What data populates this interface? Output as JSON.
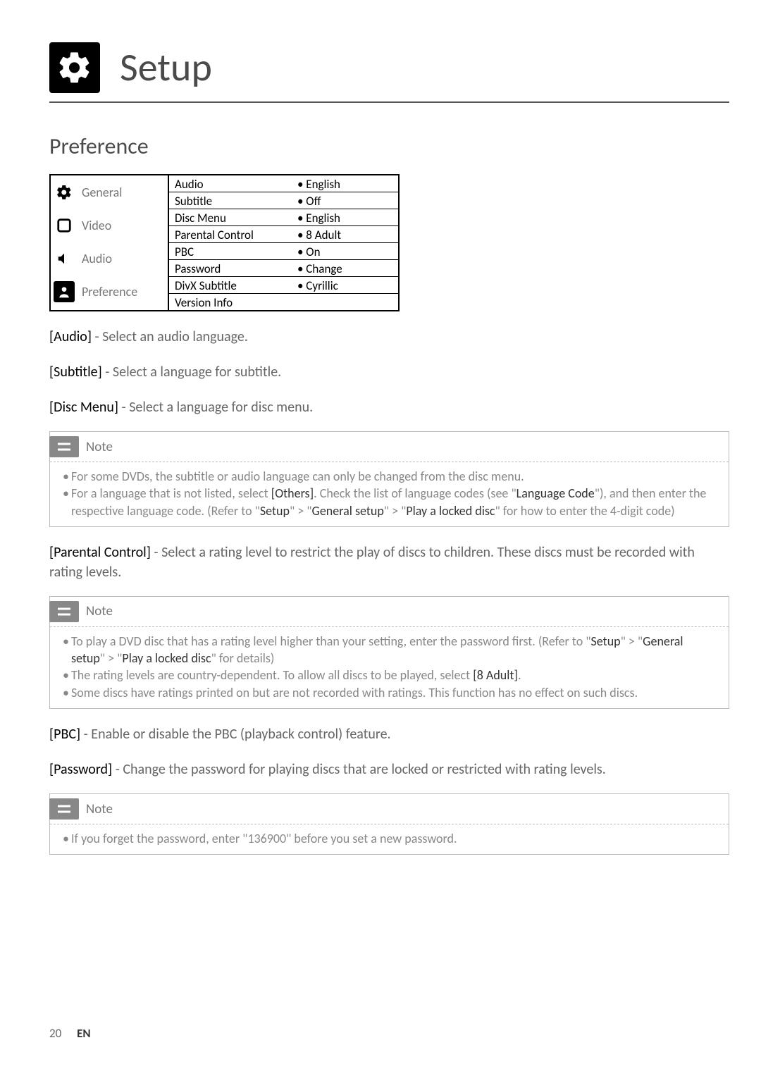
{
  "header": {
    "title": "Setup"
  },
  "section": {
    "title": "Preference"
  },
  "menu": {
    "left": [
      {
        "label": "General",
        "active": false,
        "icon": "gear"
      },
      {
        "label": "Video",
        "active": false,
        "icon": "square"
      },
      {
        "label": "Audio",
        "active": false,
        "icon": "speaker"
      },
      {
        "label": "Preference",
        "active": true,
        "icon": "user"
      }
    ],
    "right": [
      {
        "label": "Audio",
        "value": "• English"
      },
      {
        "label": "Subtitle",
        "value": "• Off"
      },
      {
        "label": "Disc Menu",
        "value": "• English"
      },
      {
        "label": "Parental Control",
        "value": "• 8 Adult"
      },
      {
        "label": "PBC",
        "value": "• On"
      },
      {
        "label": "Password",
        "value": "• Change"
      },
      {
        "label": "DivX Subtitle",
        "value": "• Cyrillic"
      },
      {
        "label": "Version Info",
        "value": ""
      }
    ]
  },
  "descriptions": {
    "audio": {
      "bold": "[Audio]",
      "text": " - Select an audio language."
    },
    "subtitle": {
      "bold": "[Subtitle]",
      "text": " - Select a language for subtitle."
    },
    "discmenu": {
      "bold": "[Disc Menu]",
      "text": " - Select a language for disc menu."
    },
    "parental": {
      "bold": "[Parental Control]",
      "text": " - Select a rating level to restrict the play of discs to children. These discs must be recorded with rating levels."
    },
    "pbc": {
      "bold": "[PBC]",
      "text": " - Enable or disable the PBC (playback control) feature."
    },
    "password": {
      "bold": "[Password]",
      "text": " - Change the password for playing discs that are locked or restricted with rating levels."
    }
  },
  "notes": {
    "label": "Note",
    "n1": {
      "i1": "For some DVDs, the subtitle or audio language can only be changed from the disc menu.",
      "i2a": "For a language that is not listed, select ",
      "i2b": "[Others]",
      "i2c": ". Check the list of language codes (see \"",
      "i2d": "Language Code",
      "i2e": "\"), and then enter the respective language code. (Refer to \"",
      "i2f": "Setup",
      "i2g": "\" > \"",
      "i2h": "General setup",
      "i2i": "\" > \"",
      "i2j": "Play a locked disc",
      "i2k": "\" for how to enter the 4-digit code)"
    },
    "n2": {
      "i1a": "To play a DVD disc that has a rating level higher than your setting, enter the password first. (Refer to \"",
      "i1b": "Setup",
      "i1c": "\" > \"",
      "i1d": "General setup",
      "i1e": "\" > \"",
      "i1f": "Play a locked disc",
      "i1g": "\" for details)",
      "i2a": "The rating levels are country-dependent. To allow all discs to be played, select ",
      "i2b": "[8 Adult]",
      "i2c": ".",
      "i3": "Some discs have ratings printed on but are not recorded with ratings. This function has no effect on such discs."
    },
    "n3": {
      "i1": "If you forget the password, enter \"136900\" before you set a new password."
    }
  },
  "footer": {
    "page": "20",
    "lang": "EN"
  }
}
